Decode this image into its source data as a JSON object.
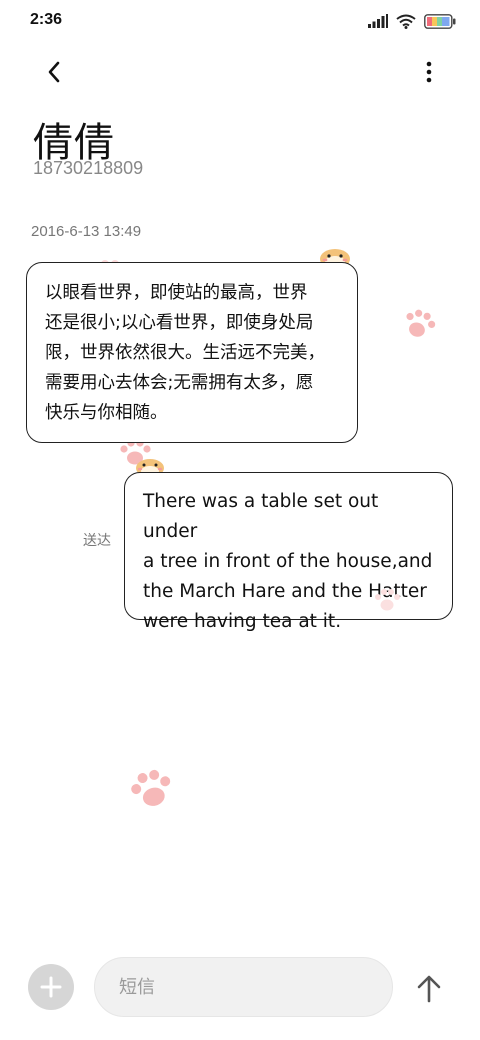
{
  "status_bar": {
    "time": "2:36",
    "icons": [
      "signal-icon",
      "wifi-icon",
      "battery-icon"
    ]
  },
  "top_bar": {
    "back_icon": "chevron-left-icon",
    "more_icon": "more-vertical-icon"
  },
  "contact": {
    "name": "倩倩",
    "number": "18730218809"
  },
  "conversation": {
    "timestamp": "2016-6-13 13:49",
    "messages": [
      {
        "direction": "incoming",
        "text": "以眼看世界，即使站的最高，世界\n还是很小;以心看世界，即使身处局\n限，世界依然很大。生活远不完美，\n需要用心去体会;无需拥有太多，愿\n快乐与你相随。"
      },
      {
        "direction": "outgoing",
        "text": "There was a table set out under\na tree in front of the house,and\nthe March Hare and the Hatter\nwere having tea at it.",
        "status": "送达"
      }
    ]
  },
  "compose": {
    "attach_icon": "plus-icon",
    "placeholder": "短信",
    "value": "",
    "send_icon": "arrow-up-icon"
  },
  "theme": {
    "bubble_border": "#222222",
    "paw_color": "#f6b8b8",
    "attach_bg": "#d6d6d6",
    "input_bg": "#f1f1f1"
  }
}
